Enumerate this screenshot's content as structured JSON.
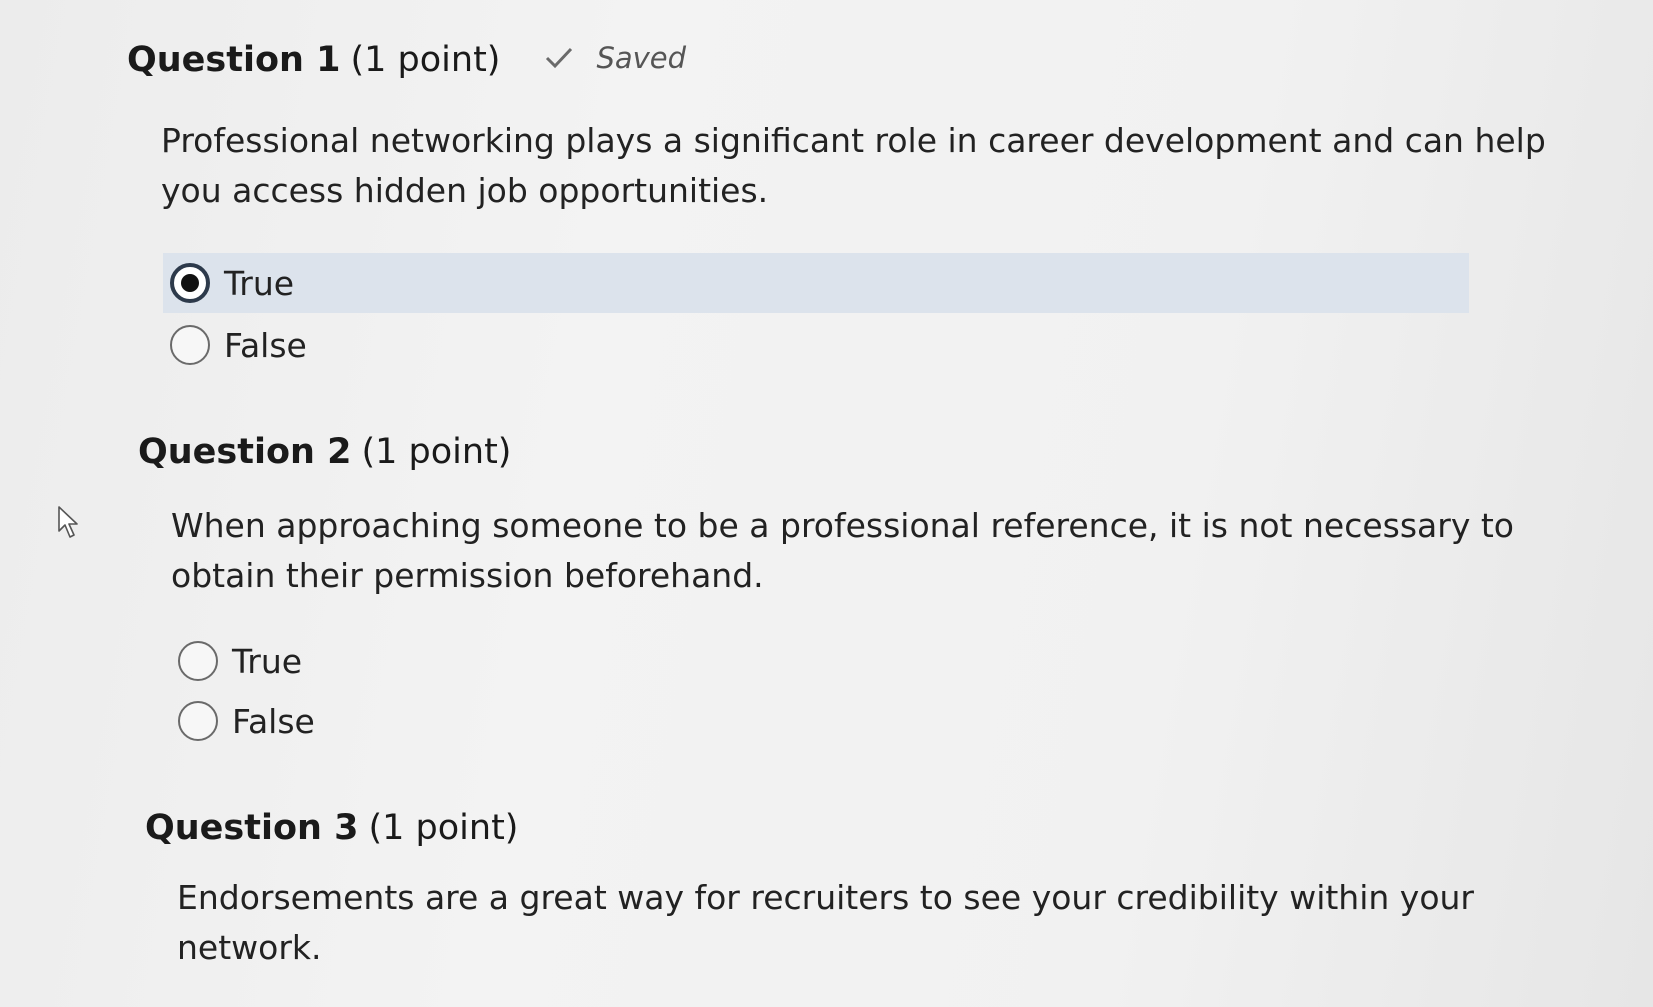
{
  "questions": [
    {
      "title": "Question 1",
      "points": "(1 point)",
      "saved_label": "Saved",
      "text_line1": "Professional networking plays a significant role in career development and can help",
      "text_line2": "you access hidden job opportunities.",
      "options": [
        {
          "label": "True",
          "selected": true
        },
        {
          "label": "False",
          "selected": false
        }
      ]
    },
    {
      "title": "Question 2",
      "points": "(1 point)",
      "text_line1": "When approaching someone to be a professional reference, it is not necessary to",
      "text_line2": "obtain their permission beforehand.",
      "options": [
        {
          "label": "True",
          "selected": false
        },
        {
          "label": "False",
          "selected": false
        }
      ]
    },
    {
      "title": "Question 3",
      "points": "(1 point)",
      "text_line1": "Endorsements are a great way for recruiters to see your credibility within your",
      "text_line2": "network."
    }
  ],
  "icons": {
    "saved": "check-icon",
    "pointer": "mouse-pointer-icon"
  },
  "colors": {
    "selected_option_bg": "#dce3ec",
    "radio_checked_border": "#2d3a4b"
  }
}
